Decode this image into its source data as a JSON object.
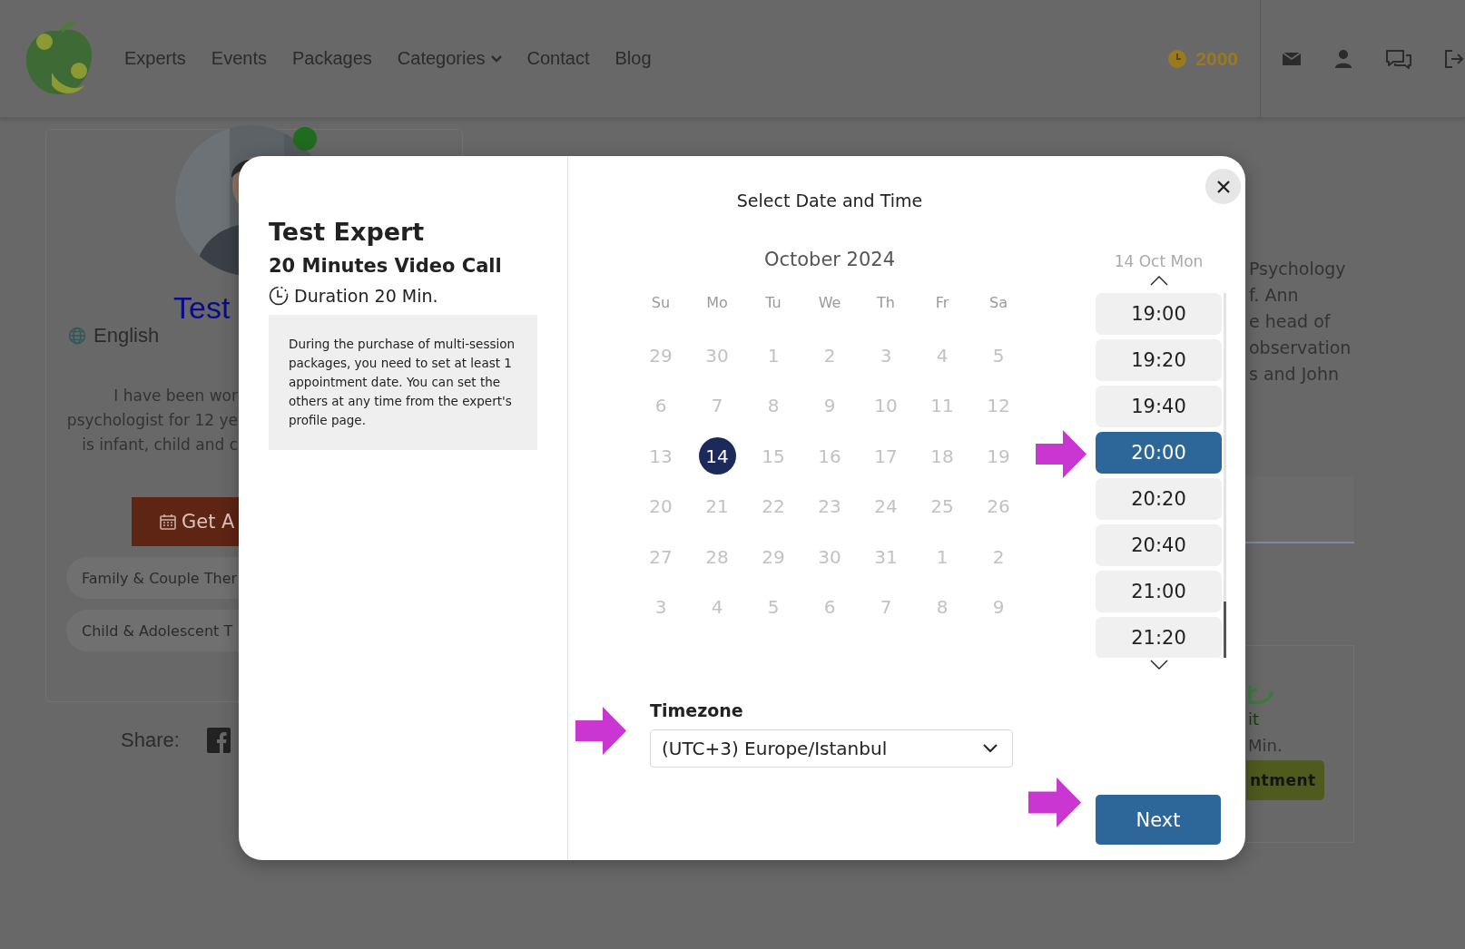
{
  "header": {
    "nav": [
      {
        "label": "Experts",
        "kind": "link"
      },
      {
        "label": "Events",
        "kind": "link"
      },
      {
        "label": "Packages",
        "kind": "link"
      },
      {
        "label": "Categories",
        "kind": "dropdown"
      },
      {
        "label": "Contact",
        "kind": "link"
      },
      {
        "label": "Blog",
        "kind": "link"
      }
    ],
    "coins": "2000"
  },
  "profile": {
    "online": true,
    "name": "Test",
    "language": "English",
    "bio": [
      "I have been wor",
      "psychologist for 12 ye",
      "is infant, child and c"
    ],
    "button": "Get A",
    "tags": [
      "Family & Couple Ther",
      "Child & Adolescent T"
    ],
    "share": "Share:"
  },
  "about": {
    "lines": [
      "Psychology",
      "f. Ann",
      "e head of",
      "observation",
      "s and John"
    ],
    "package": {
      "price": "it",
      "duration": "Min.",
      "button": "ntment"
    }
  },
  "modal": {
    "expert": "Test Expert",
    "package": "20 Minutes Video Call",
    "duration": "Duration 20 Min.",
    "note": "During the purchase of multi-session packages, you need to set at least 1 appointment date. You can set the others at any time from the expert's profile page.",
    "title": "Select Date and Time",
    "month": "October 2024",
    "weekdays": [
      "Su",
      "Mo",
      "Tu",
      "We",
      "Th",
      "Fr",
      "Sa"
    ],
    "weeks": [
      [
        {
          "label": "29",
          "selected": false
        },
        {
          "label": "30",
          "selected": false
        },
        {
          "label": "1",
          "selected": false
        },
        {
          "label": "2",
          "selected": false
        },
        {
          "label": "3",
          "selected": false
        },
        {
          "label": "4",
          "selected": false
        },
        {
          "label": "5",
          "selected": false
        }
      ],
      [
        {
          "label": "6",
          "selected": false
        },
        {
          "label": "7",
          "selected": false
        },
        {
          "label": "8",
          "selected": false
        },
        {
          "label": "9",
          "selected": false
        },
        {
          "label": "10",
          "selected": false
        },
        {
          "label": "11",
          "selected": false
        },
        {
          "label": "12",
          "selected": false
        }
      ],
      [
        {
          "label": "13",
          "selected": false
        },
        {
          "label": "14",
          "selected": true
        },
        {
          "label": "15",
          "selected": false
        },
        {
          "label": "16",
          "selected": false
        },
        {
          "label": "17",
          "selected": false
        },
        {
          "label": "18",
          "selected": false
        },
        {
          "label": "19",
          "selected": false
        }
      ],
      [
        {
          "label": "20",
          "selected": false
        },
        {
          "label": "21",
          "selected": false
        },
        {
          "label": "22",
          "selected": false
        },
        {
          "label": "23",
          "selected": false
        },
        {
          "label": "24",
          "selected": false
        },
        {
          "label": "25",
          "selected": false
        },
        {
          "label": "26",
          "selected": false
        }
      ],
      [
        {
          "label": "27",
          "selected": false
        },
        {
          "label": "28",
          "selected": false
        },
        {
          "label": "29",
          "selected": false
        },
        {
          "label": "30",
          "selected": false
        },
        {
          "label": "31",
          "selected": false
        },
        {
          "label": "1",
          "selected": false
        },
        {
          "label": "2",
          "selected": false
        }
      ],
      [
        {
          "label": "3",
          "selected": false
        },
        {
          "label": "4",
          "selected": false
        },
        {
          "label": "5",
          "selected": false
        },
        {
          "label": "6",
          "selected": false
        },
        {
          "label": "7",
          "selected": false
        },
        {
          "label": "8",
          "selected": false
        },
        {
          "label": "9",
          "selected": false
        }
      ]
    ],
    "day_heading": "14 Oct Mon",
    "slots": [
      {
        "label": "19:00",
        "selected": false
      },
      {
        "label": "19:20",
        "selected": false
      },
      {
        "label": "19:40",
        "selected": false
      },
      {
        "label": "20:00",
        "selected": true
      },
      {
        "label": "20:20",
        "selected": false
      },
      {
        "label": "20:40",
        "selected": false
      },
      {
        "label": "21:00",
        "selected": false
      },
      {
        "label": "21:20",
        "selected": false
      }
    ],
    "timezone_label": "Timezone",
    "timezone": "(UTC+3) Europe/Istanbul",
    "next": "Next"
  }
}
